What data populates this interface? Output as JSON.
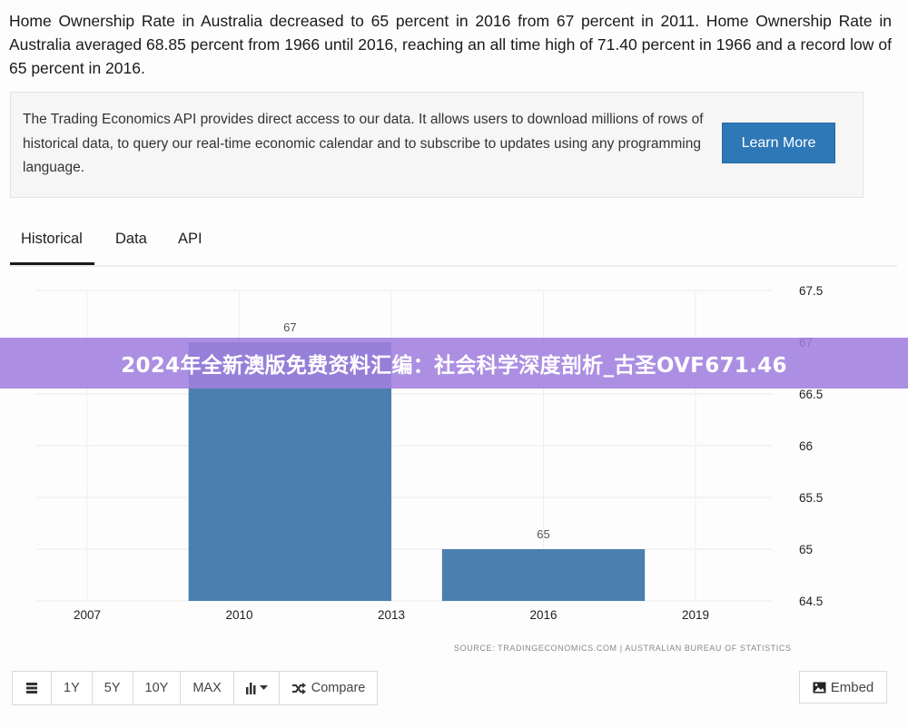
{
  "summary": "Home Ownership Rate in Australia decreased to 65 percent in 2016 from 67 percent in 2011. Home Ownership Rate in Australia averaged 68.85 percent from 1966 until 2016, reaching an all time high of 71.40 percent in 1966 and a record low of 65 percent in 2016.",
  "api_box": {
    "text": "The Trading Economics API provides direct access to our data. It allows users to download millions of rows of historical data, to query our real-time economic calendar and to subscribe to updates using any programming language.",
    "button_label": "Learn More",
    "button_color": "#2e78b8"
  },
  "tabs": [
    {
      "label": "Historical",
      "active": true
    },
    {
      "label": "Data",
      "active": false
    },
    {
      "label": "API",
      "active": false
    }
  ],
  "chart_data": {
    "type": "bar",
    "title": "",
    "xlabel": "",
    "ylabel": "",
    "categories": [
      "2011",
      "2016"
    ],
    "x": [
      2011,
      2016
    ],
    "values": [
      67,
      65
    ],
    "data_labels": [
      "67",
      "65"
    ],
    "bar_color": "#4a7fb0",
    "xlim": [
      2006,
      2020
    ],
    "ylim": [
      64.5,
      67.5
    ],
    "x_ticks": [
      "2007",
      "2010",
      "2013",
      "2016",
      "2019"
    ],
    "y_ticks": [
      "64.5",
      "65",
      "65.5",
      "66",
      "66.5",
      "67",
      "67.5"
    ],
    "y_axis_side": "right",
    "grid": true
  },
  "source": "SOURCE: TRADINGECONOMICS.COM | AUSTRALIAN BUREAU OF STATISTICS",
  "toolbar": {
    "buttons": [
      "1Y",
      "5Y",
      "10Y",
      "MAX"
    ],
    "compare_label": "Compare",
    "embed_label": "Embed"
  },
  "overlay_banner": "2024年全新澳版免费资料汇编：社会科学深度剖析_古圣OVF671.46"
}
